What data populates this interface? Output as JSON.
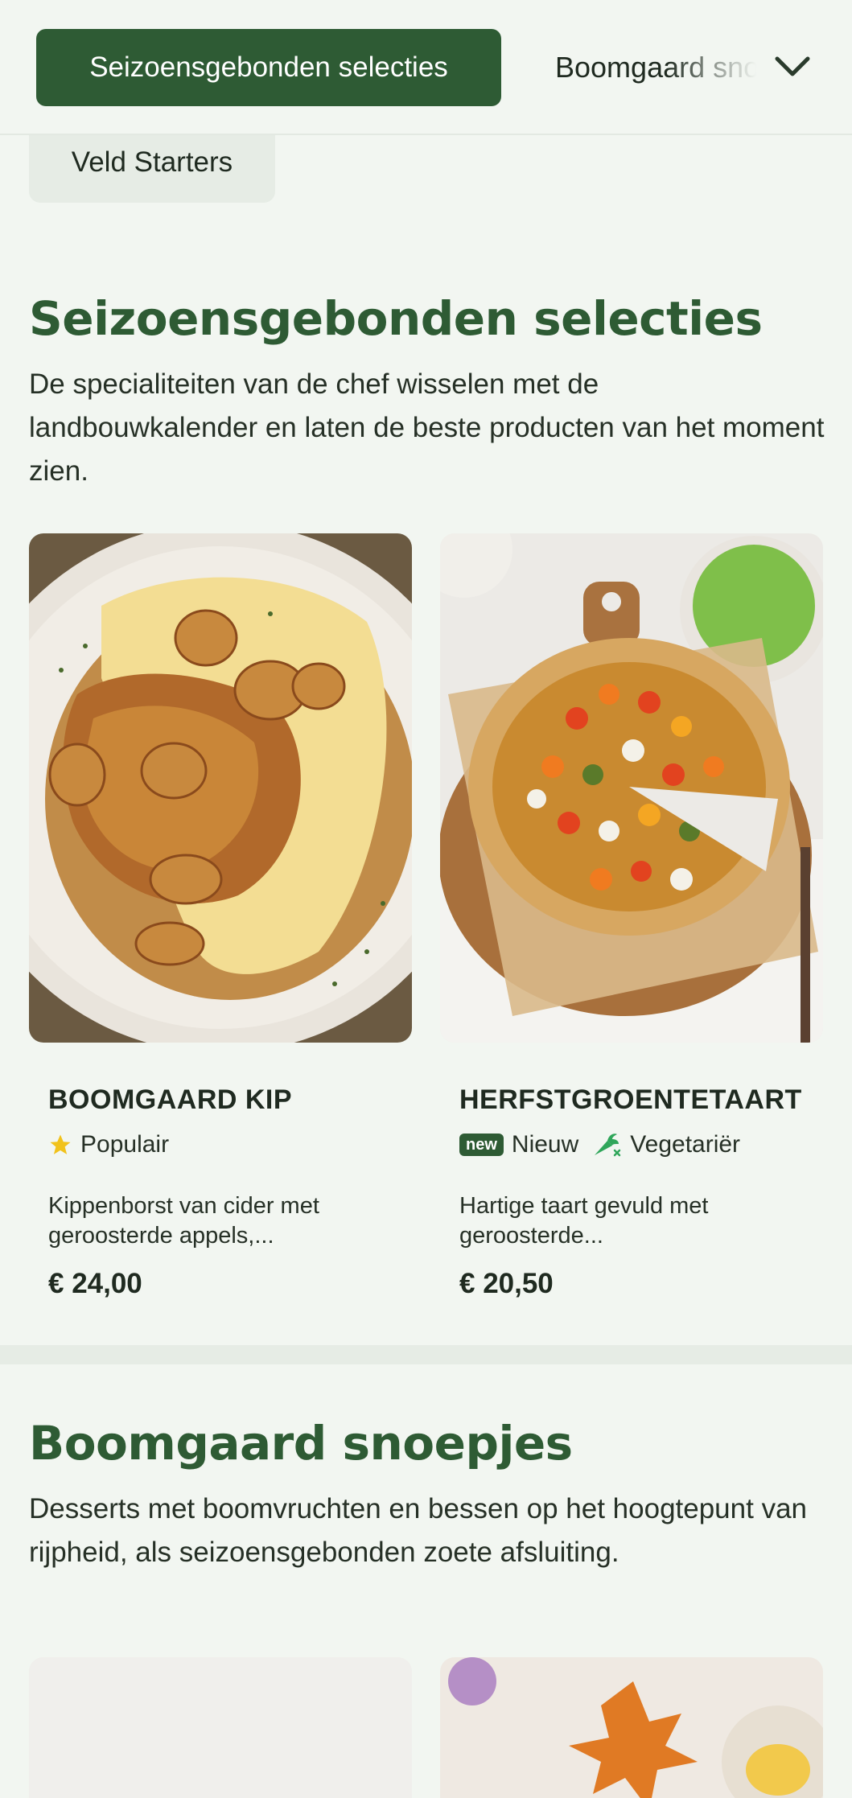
{
  "topbar": {
    "active_category": "Seizoensgebonden selecties",
    "next_category": "Boomgaard snoepjes",
    "secondary_category": "Veld Starters"
  },
  "sections": [
    {
      "title": "Seizoensgebonden selecties",
      "description": "De specialiteiten van de chef wisselen met de landbouwkalender en laten de beste producten van het moment zien.",
      "items": [
        {
          "name": "BOOMGAARD KIP",
          "badges": [
            {
              "icon": "star-icon",
              "label": "Populair"
            }
          ],
          "description": "Kippenborst van cider met geroosterde appels,...",
          "price": "€ 24,00"
        },
        {
          "name": "HERFSTGROENTETAART",
          "badges": [
            {
              "icon": "new-tag-icon",
              "tag": "new",
              "label": "Nieuw"
            },
            {
              "icon": "vegetarian-carrot-icon",
              "label": "Vegetariër"
            }
          ],
          "description": "Hartige taart gevuld met geroosterde...",
          "price": "€ 20,50"
        }
      ]
    },
    {
      "title": "Boomgaard snoepjes",
      "description": "Desserts met boomvruchten en bessen op het hoogtepunt van rijpheid, als seizoensgebonden zoete afsluiting."
    }
  ],
  "colors": {
    "brand_green": "#2e5b34",
    "background": "#f2f6f1",
    "star_yellow": "#f1c21b",
    "veg_green": "#2fa65a"
  }
}
